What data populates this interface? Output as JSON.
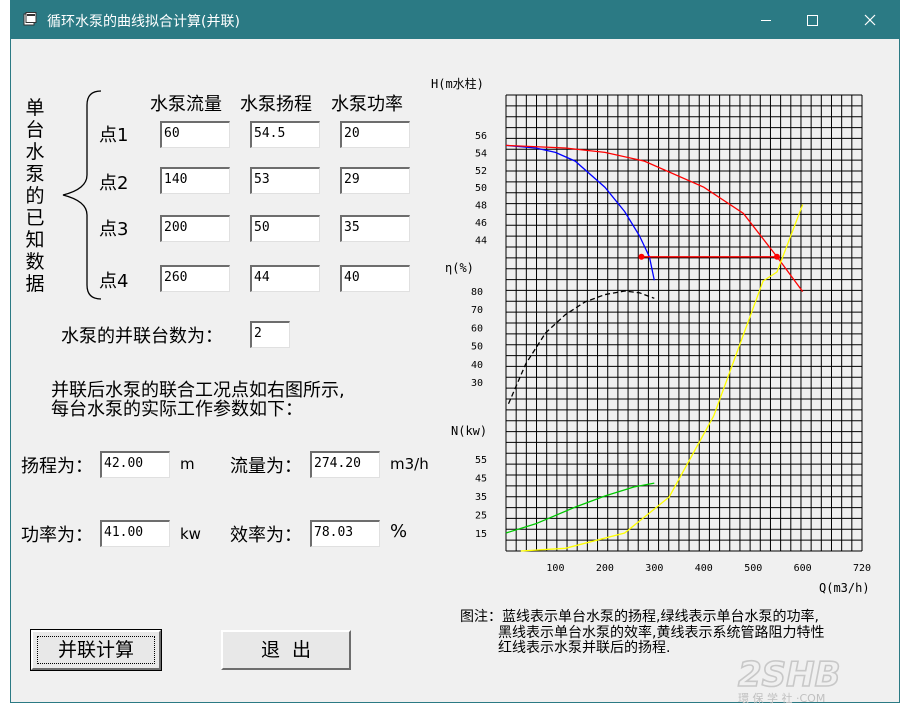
{
  "window": {
    "title": "循环水泵的曲线拟合计算(并联)"
  },
  "left": {
    "vertical_label": "单台水泵的已知数据",
    "col_headers": [
      "水泵流量",
      "水泵扬程",
      "水泵功率"
    ],
    "rows": [
      {
        "label": "点1",
        "flow": "60",
        "head": "54.5",
        "power": "20"
      },
      {
        "label": "点2",
        "flow": "140",
        "head": "53",
        "power": "29"
      },
      {
        "label": "点3",
        "flow": "200",
        "head": "50",
        "power": "35"
      },
      {
        "label": "点4",
        "flow": "260",
        "head": "44",
        "power": "40"
      }
    ],
    "parallel_label": "水泵的并联台数为：",
    "parallel_count": "2",
    "info_line1": "并联后水泵的联合工况点如右图所示,",
    "info_line2": "每台水泵的实际工作参数如下：",
    "head_label": "扬程为：",
    "head_value": "42.00",
    "head_unit": "m",
    "flow_label": "流量为：",
    "flow_value": "274.20",
    "flow_unit": "m3/h",
    "power_label": "功率为：",
    "power_value": "41.00",
    "power_unit": "kw",
    "eff_label": "效率为：",
    "eff_value": "78.03",
    "eff_unit": "%"
  },
  "buttons": {
    "calc": "并联计算",
    "exit": "退  出"
  },
  "note": {
    "line1": "图注：蓝线表示单台水泵的扬程,绿线表示单台水泵的功率,",
    "line2": "黑线表示单台水泵的效率,黄线表示系统管路阻力特性",
    "line3": "红线表示水泵并联后的扬程."
  },
  "chart_data": {
    "type": "line",
    "title": "",
    "xlabel": "Q(m3/h)",
    "xlim": [
      0,
      720
    ],
    "x_ticks": [
      "100",
      "200",
      "300",
      "400",
      "500",
      "600",
      "720"
    ],
    "axes": {
      "head": {
        "label": "H(m水柱)",
        "ticks": [
          "56",
          "54",
          "52",
          "50",
          "48",
          "46",
          "44"
        ]
      },
      "eff": {
        "label": "η(%)",
        "ticks": [
          "80",
          "70",
          "60",
          "50",
          "40",
          "30"
        ]
      },
      "power": {
        "label": "N(kw)",
        "ticks": [
          "55",
          "45",
          "35",
          "25",
          "15"
        ]
      }
    },
    "series": [
      {
        "axis": "head",
        "color": "#0000ff",
        "dash": "",
        "x": [
          0,
          60,
          100,
          140,
          200,
          240,
          270,
          290,
          300
        ],
        "y": [
          54.8,
          54.5,
          54.0,
          53.0,
          50.0,
          47.2,
          44.4,
          42.0,
          39.3
        ]
      },
      {
        "axis": "head",
        "color": "#ff0000",
        "dash": "",
        "x": [
          0,
          120,
          200,
          280,
          400,
          480,
          548,
          600
        ],
        "y": [
          54.8,
          54.5,
          54.0,
          53.0,
          50.0,
          47.0,
          42.0,
          38.0
        ]
      },
      {
        "axis": "eff",
        "color": "#000000",
        "dash": "5,3",
        "x": [
          5,
          40,
          80,
          120,
          160,
          200,
          240,
          270,
          300
        ],
        "y": [
          18,
          40,
          57,
          67,
          74,
          78,
          80,
          79,
          76
        ]
      },
      {
        "axis": "power",
        "color": "#00c800",
        "dash": "",
        "x": [
          0,
          60,
          140,
          200,
          260,
          300
        ],
        "y": [
          15,
          20,
          29,
          35,
          40,
          42
        ]
      },
      {
        "axis": "system",
        "color": "#ffff00",
        "dash": "",
        "x": [
          30,
          120,
          240,
          330,
          420,
          480,
          520,
          548,
          600
        ],
        "y": [
          0,
          3,
          20,
          60,
          150,
          240,
          300,
          310,
          385
        ]
      }
    ],
    "operating_line": {
      "x1": 274,
      "x2": 548,
      "head": 42.0,
      "color": "#ff0000"
    }
  }
}
